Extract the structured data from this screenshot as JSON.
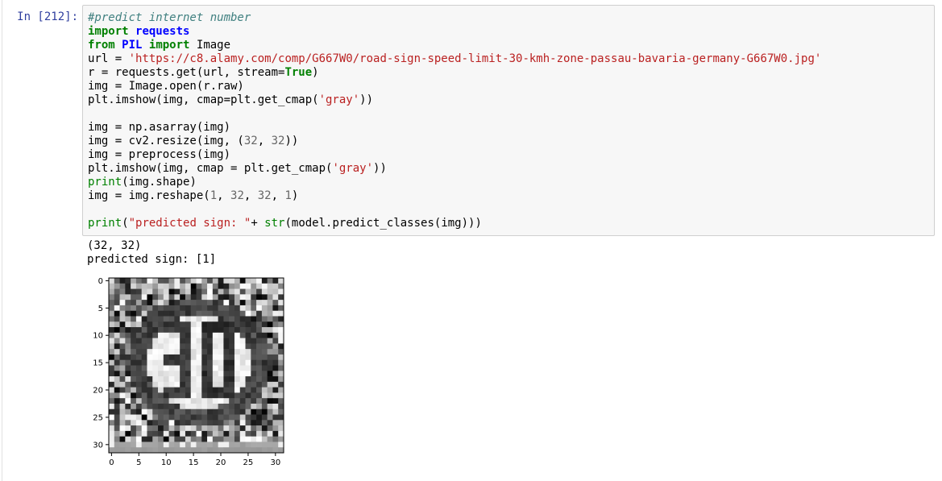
{
  "cell": {
    "prompt": "In [212]:",
    "code_lines": [
      [
        {
          "t": "#predict internet number",
          "c": "comment"
        }
      ],
      [
        {
          "t": "import",
          "c": "kw"
        },
        {
          "t": " "
        },
        {
          "t": "requests",
          "c": "mod"
        }
      ],
      [
        {
          "t": "from",
          "c": "kw"
        },
        {
          "t": " "
        },
        {
          "t": "PIL",
          "c": "mod"
        },
        {
          "t": " "
        },
        {
          "t": "import",
          "c": "kw"
        },
        {
          "t": " Image"
        }
      ],
      [
        {
          "t": "url = "
        },
        {
          "t": "'https://c8.alamy.com/comp/G667W0/road-sign-speed-limit-30-kmh-zone-passau-bavaria-germany-G667W0.jpg'",
          "c": "str"
        }
      ],
      [
        {
          "t": "r = requests.get(url, stream="
        },
        {
          "t": "True",
          "c": "kw"
        },
        {
          "t": ")"
        }
      ],
      [
        {
          "t": "img = Image.open(r.raw)"
        }
      ],
      [
        {
          "t": "plt.imshow(img, cmap=plt.get_cmap("
        },
        {
          "t": "'gray'",
          "c": "str"
        },
        {
          "t": "))"
        }
      ],
      [],
      [
        {
          "t": "img = np.asarray(img)"
        }
      ],
      [
        {
          "t": "img = cv2.resize(img, ("
        },
        {
          "t": "32",
          "c": "num"
        },
        {
          "t": ", "
        },
        {
          "t": "32",
          "c": "num"
        },
        {
          "t": "))"
        }
      ],
      [
        {
          "t": "img = preprocess(img)"
        }
      ],
      [
        {
          "t": "plt.imshow(img, cmap = plt.get_cmap("
        },
        {
          "t": "'gray'",
          "c": "str"
        },
        {
          "t": "))"
        }
      ],
      [
        {
          "t": "print",
          "c": "bi"
        },
        {
          "t": "(img.shape)"
        }
      ],
      [
        {
          "t": "img = img.reshape("
        },
        {
          "t": "1",
          "c": "num"
        },
        {
          "t": ", "
        },
        {
          "t": "32",
          "c": "num"
        },
        {
          "t": ", "
        },
        {
          "t": "32",
          "c": "num"
        },
        {
          "t": ", "
        },
        {
          "t": "1",
          "c": "num"
        },
        {
          "t": ")"
        }
      ],
      [],
      [
        {
          "t": "print",
          "c": "bi"
        },
        {
          "t": "("
        },
        {
          "t": "\"predicted sign: \"",
          "c": "str"
        },
        {
          "t": "+ "
        },
        {
          "t": "str",
          "c": "bi"
        },
        {
          "t": "(model.predict_classes(img)))"
        }
      ]
    ]
  },
  "output": {
    "line1": "(32, 32)",
    "line2": "predicted sign: [1]"
  },
  "chart_data": {
    "type": "heatmap",
    "colormap": "gray",
    "shape": [
      32,
      32
    ],
    "xlim": [
      -0.5,
      31.5
    ],
    "ylim": [
      31.5,
      -0.5
    ],
    "xticks": [
      0,
      5,
      10,
      15,
      20,
      25,
      30
    ],
    "yticks": [
      0,
      5,
      10,
      15,
      20,
      25,
      30
    ],
    "xtick_labels": [
      "0",
      "5",
      "10",
      "15",
      "20",
      "25",
      "30"
    ],
    "ytick_labels": [
      "0",
      "5",
      "10",
      "15",
      "20",
      "25",
      "30"
    ],
    "content": "32x32 grayscale preprocessed speed-limit sign showing '30'"
  }
}
